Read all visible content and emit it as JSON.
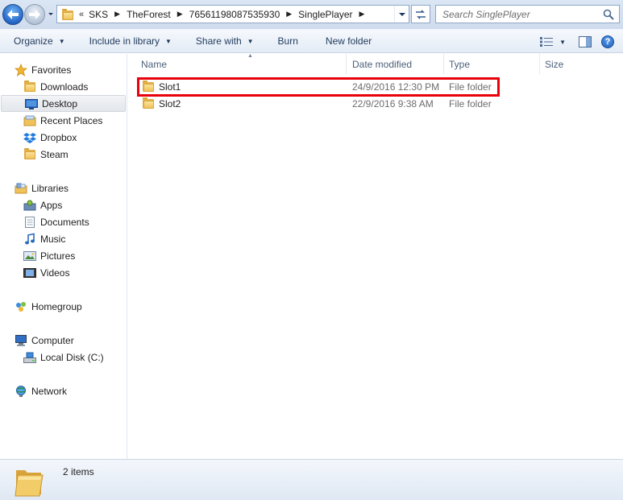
{
  "address_bar": {
    "overflow_chevron": "«",
    "breadcrumbs": [
      "SKS",
      "TheForest",
      "76561198087535930",
      "SinglePlayer"
    ],
    "search_placeholder": "Search SinglePlayer"
  },
  "toolbar": {
    "organize": "Organize",
    "include_in_library": "Include in library",
    "share_with": "Share with",
    "burn": "Burn",
    "new_folder": "New folder"
  },
  "sidebar": {
    "favorites": {
      "label": "Favorites",
      "items": [
        {
          "label": "Downloads",
          "icon": "downloads-folder-icon"
        },
        {
          "label": "Desktop",
          "icon": "desktop-icon",
          "selected": true
        },
        {
          "label": "Recent Places",
          "icon": "recent-places-icon"
        },
        {
          "label": "Dropbox",
          "icon": "dropbox-icon"
        },
        {
          "label": "Steam",
          "icon": "folder-icon"
        }
      ]
    },
    "libraries": {
      "label": "Libraries",
      "items": [
        {
          "label": "Apps",
          "icon": "apps-icon"
        },
        {
          "label": "Documents",
          "icon": "documents-icon"
        },
        {
          "label": "Music",
          "icon": "music-icon"
        },
        {
          "label": "Pictures",
          "icon": "pictures-icon"
        },
        {
          "label": "Videos",
          "icon": "videos-icon"
        }
      ]
    },
    "homegroup": {
      "label": "Homegroup"
    },
    "computer": {
      "label": "Computer",
      "items": [
        {
          "label": "Local Disk (C:)",
          "icon": "local-disk-icon"
        }
      ]
    },
    "network": {
      "label": "Network"
    }
  },
  "columns": {
    "name": "Name",
    "date_modified": "Date modified",
    "type": "Type",
    "size": "Size"
  },
  "files": [
    {
      "name": "Slot1",
      "date": "24/9/2016 12:30 PM",
      "type": "File folder",
      "highlighted": true
    },
    {
      "name": "Slot2",
      "date": "22/9/2016 9:38 AM",
      "type": "File folder",
      "highlighted": false
    }
  ],
  "status": {
    "item_count": "2 items"
  },
  "colors": {
    "highlight_border": "#e8000b",
    "toolbar_text": "#1e395b",
    "column_header_text": "#4c607a",
    "secondary_text": "#6d6d6d"
  }
}
